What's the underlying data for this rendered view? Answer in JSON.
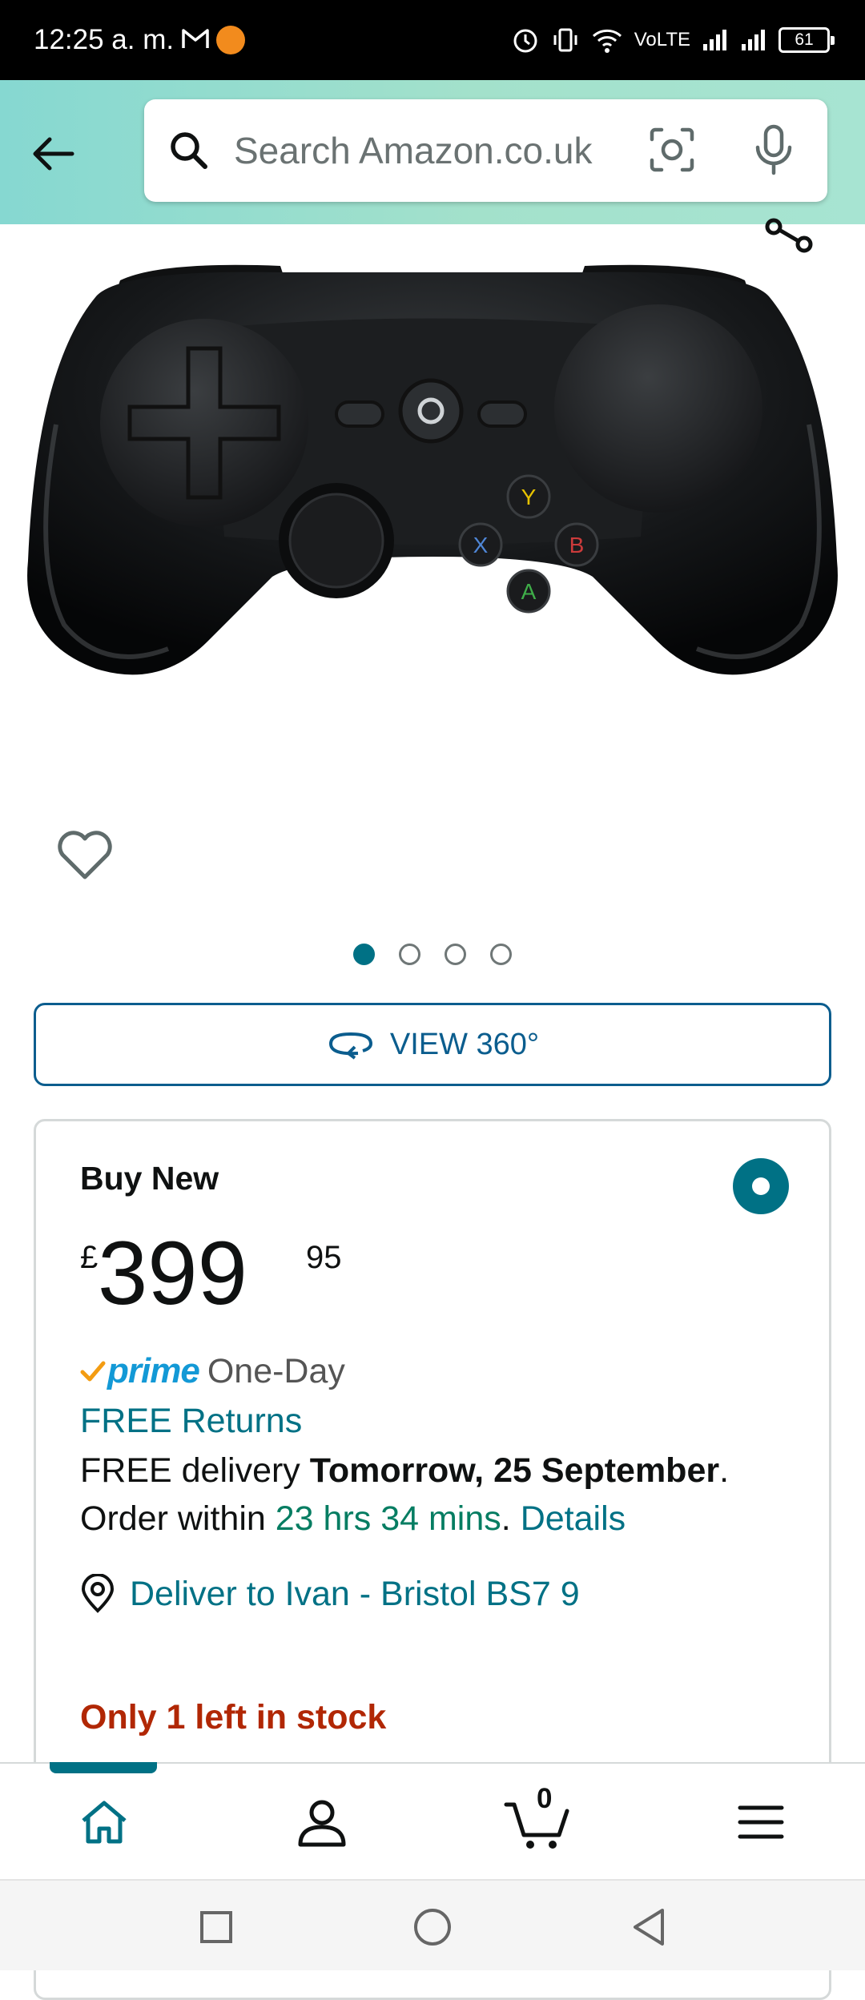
{
  "status_bar": {
    "time": "12:25 a. m.",
    "network": "VoLTE",
    "battery": "61"
  },
  "search": {
    "placeholder": "Search Amazon.co.uk"
  },
  "carousel": {
    "count": 4,
    "active_index": 0
  },
  "view360": {
    "label": "VIEW 360°"
  },
  "buybox": {
    "title": "Buy New",
    "price": {
      "symbol": "£",
      "whole": "399",
      "fraction": "95"
    },
    "prime": {
      "word": "prime",
      "service": "One-Day"
    },
    "returns": "FREE Returns",
    "delivery": {
      "prefix": "FREE delivery ",
      "date": "Tomorrow, 25 September",
      "suffix": "."
    },
    "order": {
      "prefix": "Order within ",
      "countdown": "23 hrs 34 mins",
      "separator": ". ",
      "details_link": "Details"
    },
    "deliver_to": "Deliver to Ivan - Bristol BS7 9",
    "stock": "Only 1 left in stock"
  },
  "bottom_nav": {
    "cart_count": "0"
  },
  "colors": {
    "accent": "#007185",
    "price_text": "#0f1111",
    "stock": "#b12704",
    "countdown": "#067d62",
    "link": "#007185",
    "view360": "#0b5d8e",
    "header_gradient_start": "#86d8d1",
    "header_gradient_end": "#a7e4d2"
  },
  "icons": [
    "back-arrow-icon",
    "search-icon",
    "camera-lens-icon",
    "microphone-icon",
    "share-icon",
    "heart-icon",
    "rotate-360-icon",
    "location-pin-icon",
    "home-icon",
    "account-icon",
    "cart-icon",
    "menu-icon"
  ]
}
